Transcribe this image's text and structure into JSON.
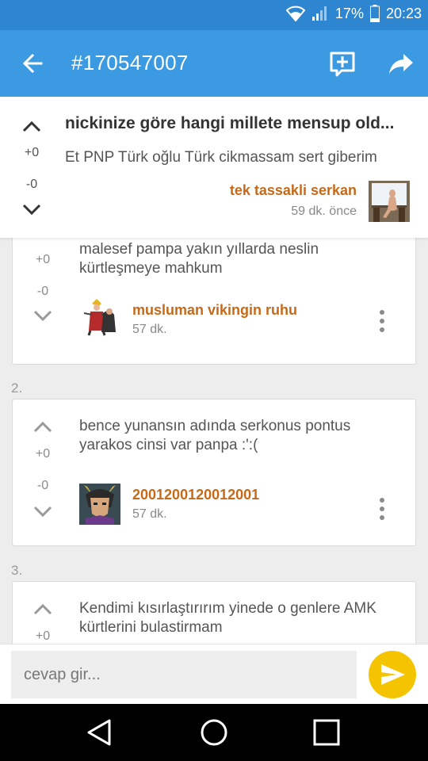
{
  "status_bar": {
    "battery": "17%",
    "time": "20:23"
  },
  "app_bar": {
    "title": "#170547007"
  },
  "topic": {
    "title": "nickinize göre hangi millete mensup old...",
    "plus": "+0",
    "minus": "-0",
    "body": "Et PNP Türk oğlu Türk cikmassam sert giberim",
    "author": "tek tassakli serkan",
    "time": "59 dk. önce"
  },
  "entries": [
    {
      "number": "",
      "text": "malesef pampa yakın yıllarda neslin kürtleşmeye mahkum",
      "plus": "+0",
      "minus": "-0",
      "author": "musluman vikingin ruhu",
      "time": "57 dk."
    },
    {
      "number": "2.",
      "text": "bence yunansın adında serkonus pontus yarakos cinsi var panpa :':(",
      "plus": "+0",
      "minus": "-0",
      "author": "2001200120012001",
      "time": "57 dk."
    },
    {
      "number": "3.",
      "text": "Kendimi kısırlaştırırım yinede o genlere AMK kürtlerini bulastirmam",
      "plus": "+0"
    }
  ],
  "reply": {
    "placeholder": "cevap gir..."
  },
  "colors": {
    "status_bar": "#2f86d0",
    "app_bar": "#3b9ae1",
    "author": "#c66a1a",
    "send_button": "#f5c400"
  }
}
